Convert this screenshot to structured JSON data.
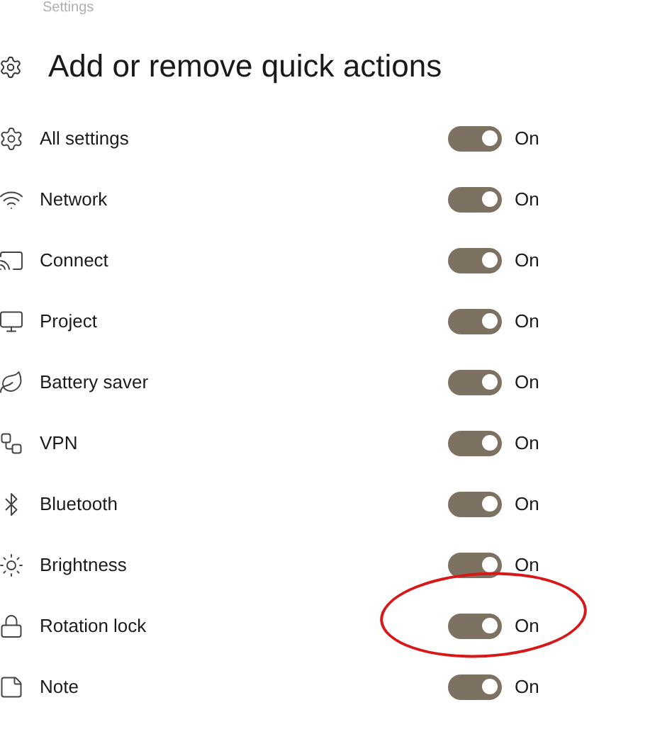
{
  "breadcrumb": "Settings",
  "title": "Add or remove quick actions",
  "items": [
    {
      "label": "All settings",
      "on": true,
      "state": "On",
      "highlighted": false
    },
    {
      "label": "Network",
      "on": true,
      "state": "On",
      "highlighted": false
    },
    {
      "label": "Connect",
      "on": true,
      "state": "On",
      "highlighted": false
    },
    {
      "label": "Project",
      "on": true,
      "state": "On",
      "highlighted": false
    },
    {
      "label": "Battery saver",
      "on": true,
      "state": "On",
      "highlighted": false
    },
    {
      "label": "VPN",
      "on": true,
      "state": "On",
      "highlighted": false
    },
    {
      "label": "Bluetooth",
      "on": true,
      "state": "On",
      "highlighted": false
    },
    {
      "label": "Brightness",
      "on": true,
      "state": "On",
      "highlighted": false
    },
    {
      "label": "Rotation lock",
      "on": true,
      "state": "On",
      "highlighted": true
    },
    {
      "label": "Note",
      "on": true,
      "state": "On",
      "highlighted": false
    }
  ]
}
